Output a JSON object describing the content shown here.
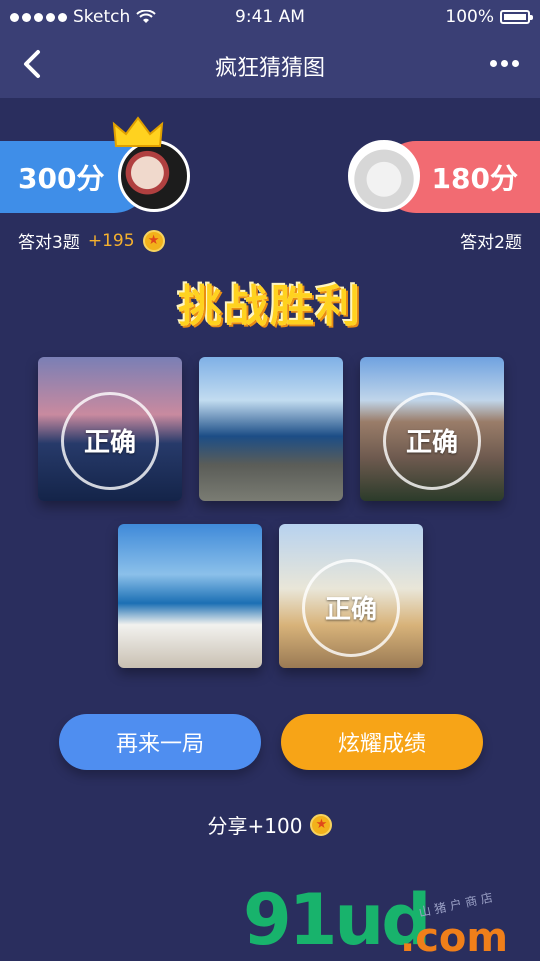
{
  "status_bar": {
    "carrier": "Sketch",
    "time": "9:41 AM",
    "battery": "100%"
  },
  "nav": {
    "title": "疯狂猜猜图"
  },
  "players": {
    "left": {
      "score": "300分",
      "correct": "答对3题",
      "bonus": "+195"
    },
    "right": {
      "score": "180分",
      "correct": "答对2题"
    }
  },
  "result": "挑战胜利",
  "stamp_label": "正确",
  "images": [
    {
      "name": "harbor-night",
      "correct": true
    },
    {
      "name": "sea-rock-fortress",
      "correct": false
    },
    {
      "name": "castle-lake",
      "correct": true
    },
    {
      "name": "santorini",
      "correct": false
    },
    {
      "name": "paris-eiffel",
      "correct": true
    }
  ],
  "buttons": {
    "again": "再来一局",
    "show_off": "炫耀成绩"
  },
  "share": "分享+100",
  "watermark": {
    "brand": "91ud",
    "domain": ".com",
    "note": "山 猪 户 商 店"
  },
  "colors": {
    "bg": "#2a2e5e",
    "blue": "#4f8ef0",
    "red": "#f26b72",
    "orange": "#f7a417",
    "gold": "#ffd21f"
  }
}
